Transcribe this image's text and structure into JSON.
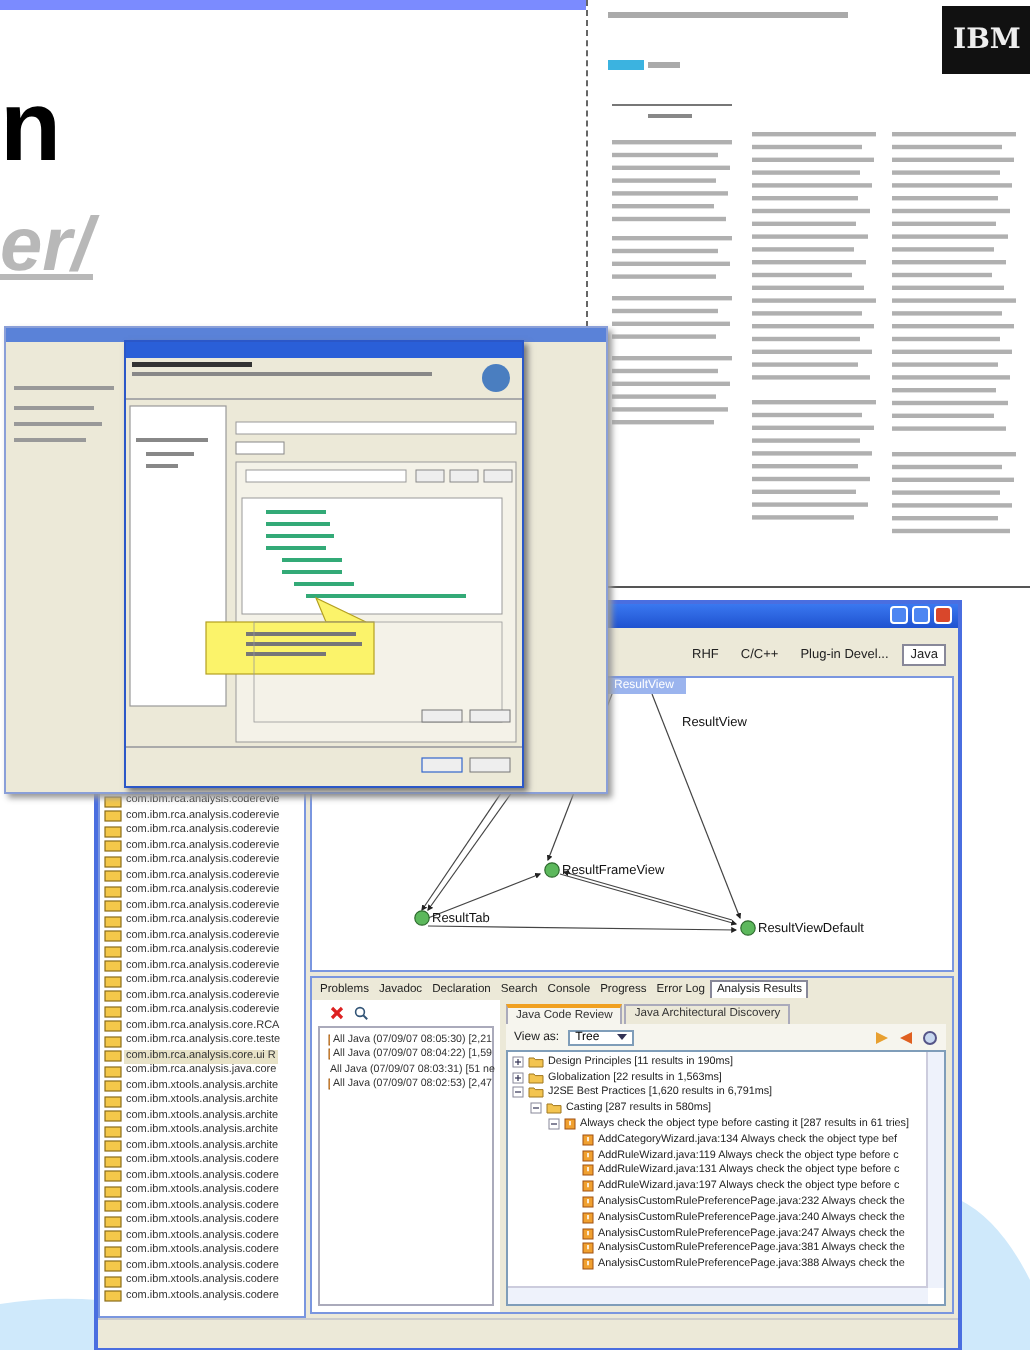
{
  "slide": {
    "title_fragment": "n",
    "link_fragment": "er/"
  },
  "document": {
    "logo": "IBM"
  },
  "main_window": {
    "perspectives": [
      {
        "label": "RHF",
        "selected": false
      },
      {
        "label": "C/C++",
        "selected": false
      },
      {
        "label": "Plug-in Devel...",
        "selected": false
      },
      {
        "label": "Java",
        "selected": true
      }
    ],
    "editor_tab": "ResultView",
    "graph": {
      "nodes": [
        {
          "label": "ResultView"
        },
        {
          "label": "ResultFrameView"
        },
        {
          "label": "ResultViewDefault"
        },
        {
          "label": "ResultTab"
        }
      ]
    },
    "package_explorer": {
      "rows": [
        {
          "label": "com.ibm.rca.analysis.coderevie",
          "selected": false
        },
        {
          "label": "com.ibm.rca.analysis.coderevie",
          "selected": false
        },
        {
          "label": "com.ibm.rca.analysis.coderevie",
          "selected": false
        },
        {
          "label": "com.ibm.rca.analysis.coderevie",
          "selected": false
        },
        {
          "label": "com.ibm.rca.analysis.coderevie",
          "selected": false
        },
        {
          "label": "com.ibm.rca.analysis.coderevie",
          "selected": false
        },
        {
          "label": "com.ibm.rca.analysis.coderevie",
          "selected": false
        },
        {
          "label": "com.ibm.rca.analysis.coderevie",
          "selected": false
        },
        {
          "label": "com.ibm.rca.analysis.coderevie",
          "selected": false
        },
        {
          "label": "com.ibm.rca.analysis.coderevie",
          "selected": false
        },
        {
          "label": "com.ibm.rca.analysis.coderevie",
          "selected": false
        },
        {
          "label": "com.ibm.rca.analysis.coderevie",
          "selected": false
        },
        {
          "label": "com.ibm.rca.analysis.coderevie",
          "selected": false
        },
        {
          "label": "com.ibm.rca.analysis.coderevie",
          "selected": false
        },
        {
          "label": "com.ibm.rca.analysis.coderevie",
          "selected": false
        },
        {
          "label": "com.ibm.rca.analysis.core.RCA",
          "selected": false
        },
        {
          "label": "com.ibm.rca.analysis.core.teste",
          "selected": false
        },
        {
          "label": "com.ibm.rca.analysis.core.ui R",
          "selected": true
        },
        {
          "label": "com.ibm.rca.analysis.java.core",
          "selected": false
        },
        {
          "label": "com.ibm.xtools.analysis.archite",
          "selected": false
        },
        {
          "label": "com.ibm.xtools.analysis.archite",
          "selected": false
        },
        {
          "label": "com.ibm.xtools.analysis.archite",
          "selected": false
        },
        {
          "label": "com.ibm.xtools.analysis.archite",
          "selected": false
        },
        {
          "label": "com.ibm.xtools.analysis.archite",
          "selected": false
        },
        {
          "label": "com.ibm.xtools.analysis.codere",
          "selected": false
        },
        {
          "label": "com.ibm.xtools.analysis.codere",
          "selected": false
        },
        {
          "label": "com.ibm.xtools.analysis.codere",
          "selected": false
        },
        {
          "label": "com.ibm.xtools.analysis.codere",
          "selected": false
        },
        {
          "label": "com.ibm.xtools.analysis.codere",
          "selected": false
        },
        {
          "label": "com.ibm.xtools.analysis.codere",
          "selected": false
        },
        {
          "label": "com.ibm.xtools.analysis.codere",
          "selected": false
        },
        {
          "label": "com.ibm.xtools.analysis.codere",
          "selected": false
        },
        {
          "label": "com.ibm.xtools.analysis.codere",
          "selected": false
        },
        {
          "label": "com.ibm.xtools.analysis.codere",
          "selected": false
        }
      ]
    },
    "bottom_tabs": [
      {
        "label": "Problems",
        "selected": false
      },
      {
        "label": "Javadoc",
        "selected": false
      },
      {
        "label": "Declaration",
        "selected": false
      },
      {
        "label": "Search",
        "selected": false
      },
      {
        "label": "Console",
        "selected": false
      },
      {
        "label": "Progress",
        "selected": false
      },
      {
        "label": "Error Log",
        "selected": false
      },
      {
        "label": "Analysis Results",
        "selected": true
      }
    ],
    "history": [
      "All Java (07/09/07 08:05:30) [2,21",
      "All Java (07/09/07 08:04:22) [1,59",
      "All Java (07/09/07 08:03:31) [51 ne",
      "All Java (07/09/07 08:02:53) [2,47"
    ],
    "results": {
      "tabs": [
        {
          "label": "Java Code Review",
          "selected": true
        },
        {
          "label": "Java Architectural Discovery",
          "selected": false
        }
      ],
      "view_as_label": "View as:",
      "view_as_value": "Tree",
      "tree": [
        {
          "kind": "category",
          "label": "Design Principles [11 results in 190ms]",
          "expanded": false
        },
        {
          "kind": "category",
          "label": "Globalization [22 results in 1,563ms]",
          "expanded": false
        },
        {
          "kind": "category",
          "label": "J2SE Best Practices [1,620 results in 6,791ms]",
          "expanded": true,
          "children": [
            {
              "kind": "category",
              "label": "Casting [287 results in 580ms]",
              "expanded": true,
              "children": [
                {
                  "kind": "rule",
                  "label": "Always check the object type before casting it [287 results in 61 tries]",
                  "expanded": true,
                  "children": [
                    {
                      "kind": "result",
                      "label": "AddCategoryWizard.java:134 Always check the object type bef"
                    },
                    {
                      "kind": "result",
                      "label": "AddRuleWizard.java:119 Always check the object type before c"
                    },
                    {
                      "kind": "result",
                      "label": "AddRuleWizard.java:131 Always check the object type before c"
                    },
                    {
                      "kind": "result",
                      "label": "AddRuleWizard.java:197 Always check the object type before c"
                    },
                    {
                      "kind": "result",
                      "label": "AnalysisCustomRulePreferencePage.java:232 Always check the"
                    },
                    {
                      "kind": "result",
                      "label": "AnalysisCustomRulePreferencePage.java:240 Always check the"
                    },
                    {
                      "kind": "result",
                      "label": "AnalysisCustomRulePreferencePage.java:247 Always check the"
                    },
                    {
                      "kind": "result",
                      "label": "AnalysisCustomRulePreferencePage.java:381 Always check the"
                    },
                    {
                      "kind": "result",
                      "label": "AnalysisCustomRulePreferencePage.java:388 Always check the"
                    }
                  ]
                }
              ]
            }
          ]
        }
      ]
    }
  }
}
